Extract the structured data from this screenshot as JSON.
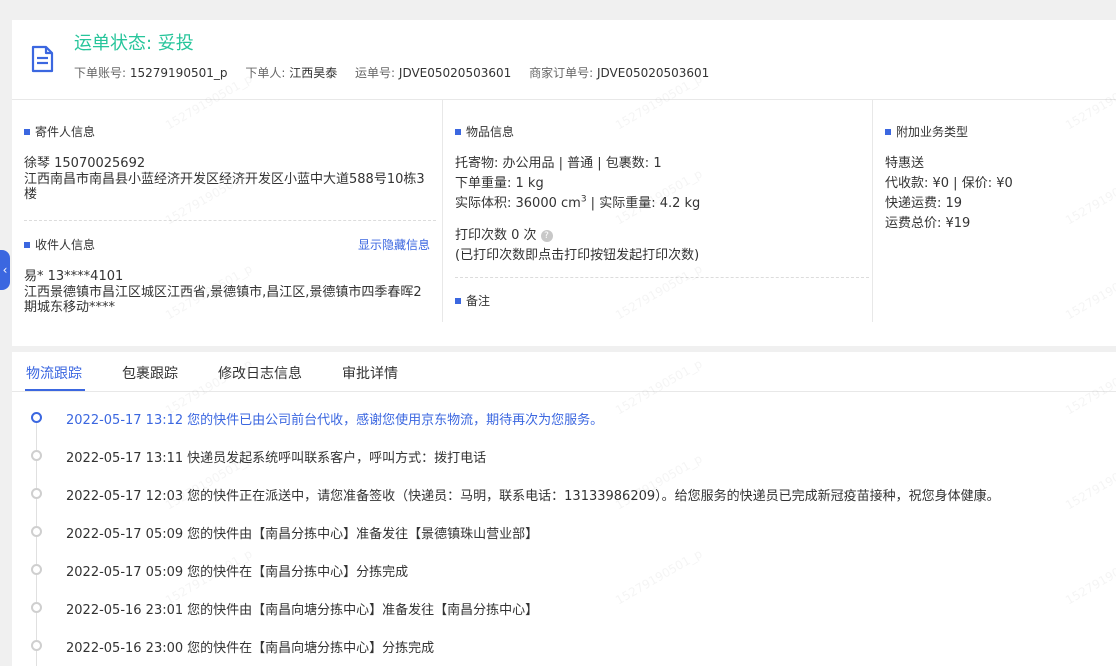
{
  "header": {
    "status_label": "运单状态: 妥投",
    "order_account": {
      "label": "下单账号:",
      "value": "15279190501_p"
    },
    "orderer": {
      "label": "下单人:",
      "value": "江西昊泰"
    },
    "waybill": {
      "label": "运单号:",
      "value": "JDVE05020503601"
    },
    "merchant_order": {
      "label": "商家订单号:",
      "value": "JDVE05020503601"
    },
    "icon": "document-icon",
    "status_color": "#27c59b"
  },
  "sender": {
    "title": "寄件人信息",
    "name_phone": "徐琴   15070025692",
    "address": "江西南昌市南昌县小蓝经济开发区经济开发区小蓝中大道588号10栋3楼"
  },
  "receiver": {
    "title": "收件人信息",
    "show_hidden": "显示隐藏信息",
    "name_phone": "易*    13****4101",
    "address": "江西景德镇市昌江区城区江西省,景德镇市,昌江区,景德镇市四季春晖2期城东移动****"
  },
  "goods": {
    "title": "物品信息",
    "line1": "托寄物:  办公用品 | 普通  |  包裹数:  1",
    "line2": "下单重量:   1 kg",
    "volume_label": "实际体积:   36000 cm",
    "volume_sup": "3",
    "volume_rest": " | 实际重量:   4.2 kg",
    "print_count": "打印次数   0 次",
    "print_note": "(已打印次数即点击打印按钮发起打印次数)"
  },
  "remark": {
    "title": "备注"
  },
  "extra": {
    "title": "附加业务类型",
    "service": "特惠送",
    "cod": "代收款:  ¥0  |  保价:  ¥0",
    "freight": "快递运费:   19",
    "total": "运费总价:   ¥19"
  },
  "tabs": [
    "物流跟踪",
    "包裹跟踪",
    "修改日志信息",
    "审批详情"
  ],
  "events": [
    {
      "time": "2022-05-17 13:12",
      "text": "您的快件已由公司前台代收，感谢您使用京东物流，期待再次为您服务。",
      "active": true
    },
    {
      "time": "2022-05-17 13:11",
      "text": "快递员发起系统呼叫联系客户，呼叫方式：拨打电话",
      "active": false
    },
    {
      "time": "2022-05-17 12:03",
      "text": "您的快件正在派送中，请您准备签收（快递员：马明，联系电话：13133986209）。给您服务的快递员已完成新冠疫苗接种，祝您身体健康。",
      "active": false
    },
    {
      "time": "2022-05-17 05:09",
      "text": "您的快件由【南昌分拣中心】准备发往【景德镇珠山营业部】",
      "active": false
    },
    {
      "time": "2022-05-17 05:09",
      "text": "您的快件在【南昌分拣中心】分拣完成",
      "active": false
    },
    {
      "time": "2022-05-16 23:01",
      "text": "您的快件由【南昌向塘分拣中心】准备发往【南昌分拣中心】",
      "active": false
    },
    {
      "time": "2022-05-16 23:00",
      "text": "您的快件在【南昌向塘分拣中心】分拣完成",
      "active": false
    }
  ],
  "watermark": "15279190501_p",
  "accent_color": "#3b67e0"
}
